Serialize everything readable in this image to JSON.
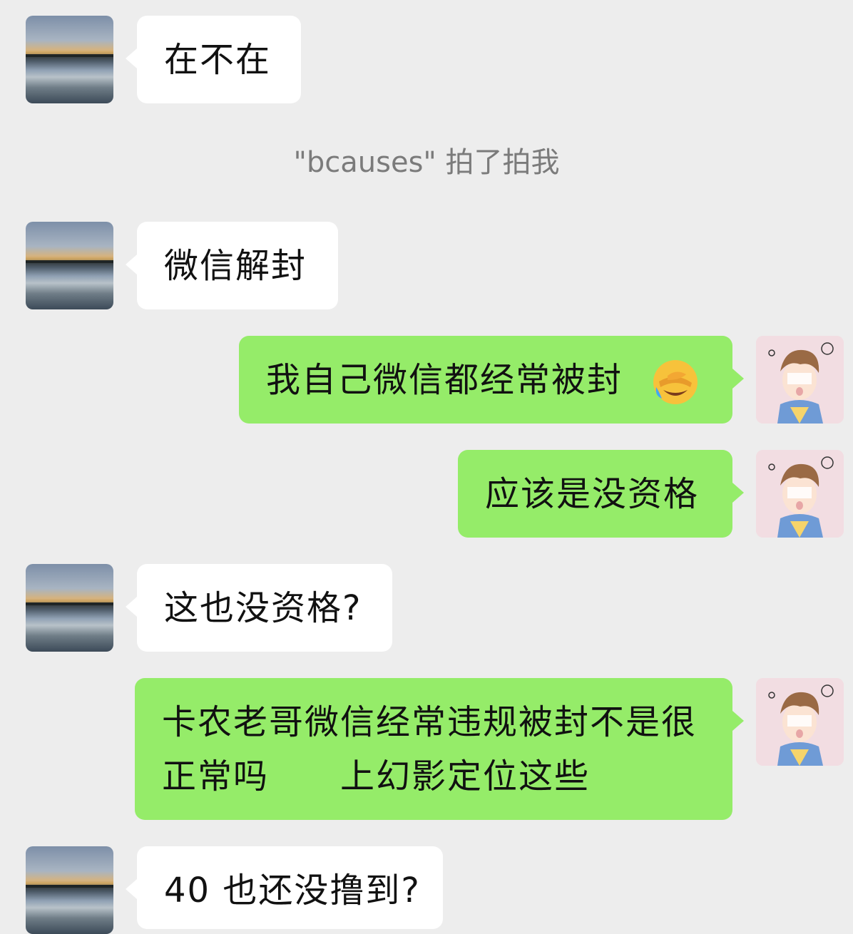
{
  "contact": {
    "name": "bcauses"
  },
  "system": {
    "pat_text": "\"bcauses\" 拍了拍我"
  },
  "messages": [
    {
      "side": "left",
      "text": "在不在"
    },
    {
      "side": "left",
      "text": "微信解封"
    },
    {
      "side": "right",
      "text": "我自己微信都经常被封",
      "emoji": "face-palm-laughing-emoji"
    },
    {
      "side": "right",
      "text": "应该是没资格"
    },
    {
      "side": "left",
      "text": "这也没资格?"
    },
    {
      "side": "right",
      "line1": "卡农老哥微信经常违规被封不是很",
      "line2": "正常吗　　上幻影定位这些"
    },
    {
      "side": "left",
      "text": "40 也还没撸到?"
    }
  ],
  "colors": {
    "background": "#ededed",
    "incoming_bubble": "#ffffff",
    "outgoing_bubble": "#95ec69",
    "system_text": "#7b7b7b"
  }
}
